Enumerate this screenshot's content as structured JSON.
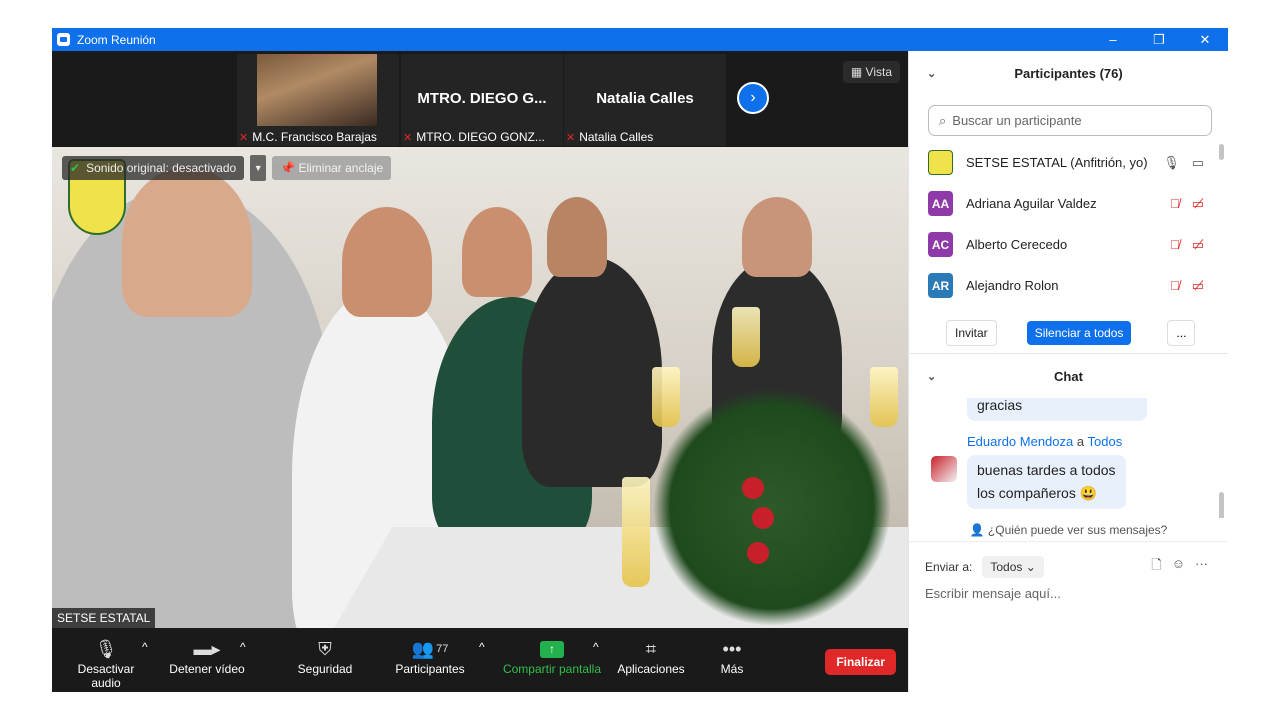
{
  "window": {
    "title": "Zoom Reunión",
    "controls": [
      "–",
      "❐",
      "✕"
    ]
  },
  "thumbnails": [
    {
      "display": "",
      "label": "M.C. Francisco Barajas",
      "has_video": true
    },
    {
      "display": "MTRO. DIEGO G...",
      "label": "MTRO. DIEGO GONZ...",
      "has_video": false
    },
    {
      "display": "Natalia Calles",
      "label": "Natalia Calles",
      "has_video": false
    }
  ],
  "view_button": "Vista",
  "video": {
    "sound_badge": "Sonido original: desactivado",
    "unpin_badge": "Eliminar anclaje",
    "speaker_name": "SETSE ESTATAL"
  },
  "toolbar": {
    "mute": "Desactivar audio",
    "stop_video": "Detener vídeo",
    "security": "Seguridad",
    "participants": "Participantes",
    "participants_count": "77",
    "share": "Compartir pantalla",
    "apps": "Aplicaciones",
    "more": "Más",
    "end": "Finalizar"
  },
  "participants_panel": {
    "title": "Participantes (76)",
    "search_placeholder": "Buscar un participante",
    "rows": [
      {
        "initials": "",
        "name": "SETSE ESTATAL (Anfitrión, yo)",
        "color": "#f0e24a",
        "muted": false
      },
      {
        "initials": "AA",
        "name": "Adriana Aguilar Valdez",
        "color": "#8e3aa8",
        "muted": true
      },
      {
        "initials": "AC",
        "name": "Alberto Cerecedo",
        "color": "#8e3aa8",
        "muted": true
      },
      {
        "initials": "AR",
        "name": "Alejandro Rolon",
        "color": "#2a7ab8",
        "muted": true
      }
    ],
    "invite": "Invitar",
    "mute_all": "Silenciar a todos",
    "more": "..."
  },
  "chat": {
    "title": "Chat",
    "prev_message": "gracias",
    "sender": "Eduardo Mendoza",
    "to_word": "a",
    "recipient": "Todos",
    "message_line1": "buenas tardes a todos",
    "message_line2": "los compañeros 😃",
    "who_can_see": "¿Quién puede ver sus mensajes?",
    "send_to_label": "Enviar a:",
    "send_to_value": "Todos",
    "compose_placeholder": "Escribir mensaje aquí..."
  }
}
